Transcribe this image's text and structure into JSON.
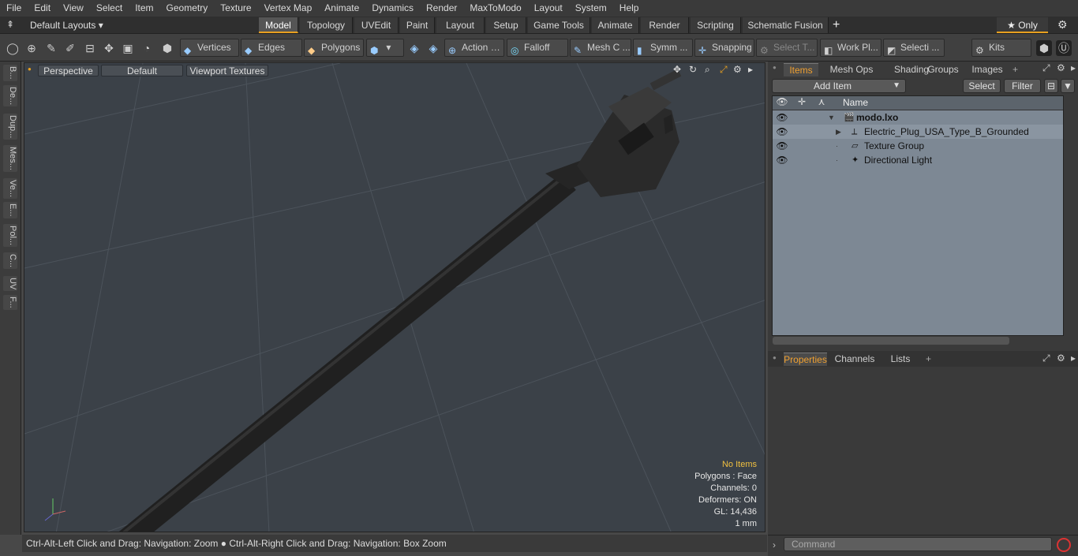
{
  "menu": [
    "File",
    "Edit",
    "View",
    "Select",
    "Item",
    "Geometry",
    "Texture",
    "Vertex Map",
    "Animate",
    "Dynamics",
    "Render",
    "MaxToModo",
    "Layout",
    "System",
    "Help"
  ],
  "layouts_label": "Default Layouts ▾",
  "layout_tabs": [
    "Model",
    "Topology",
    "UVEdit",
    "Paint",
    "Layout",
    "Setup",
    "Game Tools",
    "Animate",
    "Render",
    "Scripting",
    "Schematic Fusion"
  ],
  "add_tab": "+",
  "only_label": "★  Only",
  "toolbar": {
    "vertices": "Vertices",
    "edges": "Edges",
    "polygons": "Polygons",
    "action": "Action",
    "falloff": "Falloff",
    "mesh": "Mesh C ...",
    "symm": "Symm ...",
    "snapping": "Snapping",
    "select_t": "Select T...",
    "work_pl": "Work Pl...",
    "selecti": "Selecti ...",
    "kits": "Kits"
  },
  "left_tabs": [
    "B...",
    "De...",
    "Dup...",
    "Mes...",
    "Ve...",
    "E...",
    "Pol...",
    "C...",
    "UV",
    "F..."
  ],
  "viewport": {
    "view": "Perspective",
    "shading": "Default",
    "textures": "Viewport Textures",
    "stats": {
      "noitems": "No Items",
      "polygons": "Polygons : Face",
      "channels": "Channels: 0",
      "deformers": "Deformers: ON",
      "gl": "GL: 14,436",
      "unit": "1 mm"
    }
  },
  "statusbar": "Ctrl-Alt-Left Click and Drag: Navigation: Zoom ●  Ctrl-Alt-Right Click and Drag: Navigation: Box Zoom",
  "items_panel": {
    "tabs": [
      "Items",
      "Mesh Ops",
      "Shading",
      "Groups",
      "Images"
    ],
    "add_item": "Add Item",
    "select": "Select",
    "filter": "Filter",
    "name_col": "Name",
    "rows": [
      {
        "label": "modo.lxo",
        "bold": true
      },
      {
        "label": "Electric_Plug_USA_Type_B_Grounded"
      },
      {
        "label": "Texture Group"
      },
      {
        "label": "Directional Light"
      }
    ]
  },
  "props_panel": {
    "tabs": [
      "Properties",
      "Channels",
      "Lists"
    ]
  },
  "command_placeholder": "Command",
  "colors": {
    "accent": "#e8a020",
    "viewport_bg": "#3b4148",
    "list_bg": "#7d8894"
  }
}
